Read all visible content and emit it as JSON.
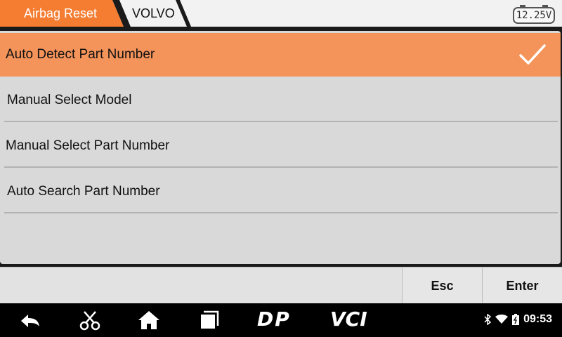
{
  "breadcrumb": {
    "items": [
      "Airbag Reset",
      "VOLVO"
    ],
    "accent_color": "#f47d32"
  },
  "battery": {
    "voltage": "12.25V"
  },
  "menu": {
    "items": [
      {
        "label": "Auto Detect Part Number",
        "selected": true
      },
      {
        "label": "Manual Select Model",
        "selected": false
      },
      {
        "label": "Manual Select Part Number",
        "selected": false
      },
      {
        "label": "Auto Search Part Number",
        "selected": false
      }
    ],
    "selected_color": "#f4935a"
  },
  "buttons": {
    "esc": "Esc",
    "enter": "Enter"
  },
  "navbar": {
    "icons": [
      "back-icon",
      "scissors-icon",
      "home-icon",
      "recent-apps-icon"
    ],
    "dp_label": "DP",
    "vci_label": "VCI",
    "status_icons": [
      "bluetooth-icon",
      "wifi-icon",
      "battery-icon"
    ],
    "time": "09:53"
  }
}
